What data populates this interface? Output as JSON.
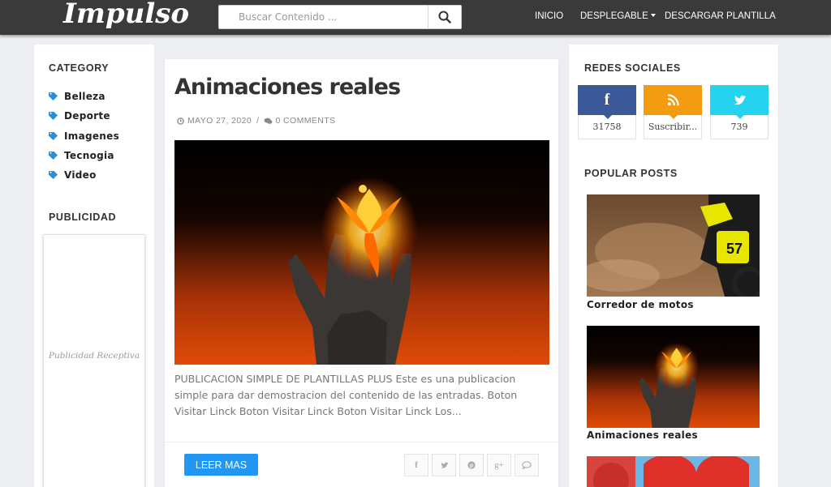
{
  "header": {
    "logo": "Impulso",
    "search_placeholder": "Buscar Contenido ...",
    "nav": {
      "inicio": "INICIO",
      "desplegable": "DESPLEGABLE",
      "descargar": "DESCARGAR PLANTILLA"
    }
  },
  "left_sidebar": {
    "category_heading": "CATEGORY",
    "categories": [
      "Belleza",
      "Deporte",
      "Imagenes",
      "Tecnogia",
      "Video"
    ],
    "ad_heading": "PUBLICIDAD",
    "ad_text": "Publicidad Receptiva"
  },
  "post": {
    "title": "Animaciones reales",
    "date": "MAYO 27, 2020",
    "separator": "/",
    "comments": "0 COMMENTS",
    "excerpt": "PUBLICACION SIMPLE DE PLANTILLAS PLUS Este es una publicacion simple para dar demostracion del contenido de las entradas. Boton Visitar Linck Boton Visitar Linck Boton Visitar Linck Los...",
    "read_more": "LEER MAS",
    "share_icons": [
      "facebook-icon",
      "twitter-icon",
      "pinterest-icon",
      "google-plus-icon",
      "comment-icon"
    ]
  },
  "right_sidebar": {
    "social_heading": "REDES SOCIALES",
    "social": [
      {
        "network": "facebook",
        "count": "31758",
        "color": "#3b5998"
      },
      {
        "network": "rss",
        "count": "Suscribir...",
        "color": "#f39c12"
      },
      {
        "network": "twitter",
        "count": "739",
        "color": "#26d3ef"
      }
    ],
    "popular_heading": "POPULAR POSTS",
    "popular_posts": [
      {
        "title": "Corredor de motos"
      },
      {
        "title": "Animaciones reales"
      }
    ]
  },
  "colors": {
    "header_bg": "#3a3a3a",
    "accent_button": "#2196f3",
    "tag_icon": "#2b8fd6",
    "page_bg": "#eceef2"
  }
}
